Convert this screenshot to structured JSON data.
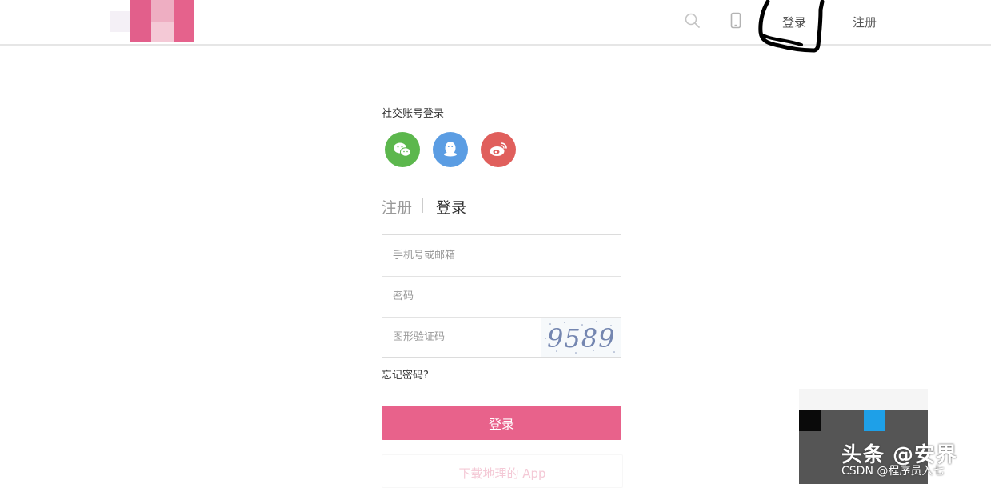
{
  "header": {
    "logo": "site-logo",
    "nav": {
      "login_label": "登录",
      "register_label": "注册"
    },
    "icons": [
      "search-icon",
      "phone-icon"
    ]
  },
  "login_panel": {
    "social_title": "社交账号登录",
    "social_icons": [
      "wechat-icon",
      "qq-icon",
      "weibo-icon"
    ],
    "tabs": {
      "register_label": "注册",
      "login_label": "登录"
    },
    "fields": {
      "phone_email_placeholder": "手机号或邮箱",
      "password_placeholder": "密码",
      "captcha_placeholder": "图形验证码"
    },
    "captcha_code": "9589",
    "forgot_label": "忘记密码?",
    "submit_label": "登录",
    "app_download_label": "下载地理的 App"
  },
  "watermark": {
    "line1": "头条 @安界",
    "line2": "CSDN @程序员入七"
  },
  "colors": {
    "accent": "#e8628b",
    "wechat": "#5cb74d",
    "qq": "#5b9de3",
    "weibo": "#e05f5c"
  }
}
